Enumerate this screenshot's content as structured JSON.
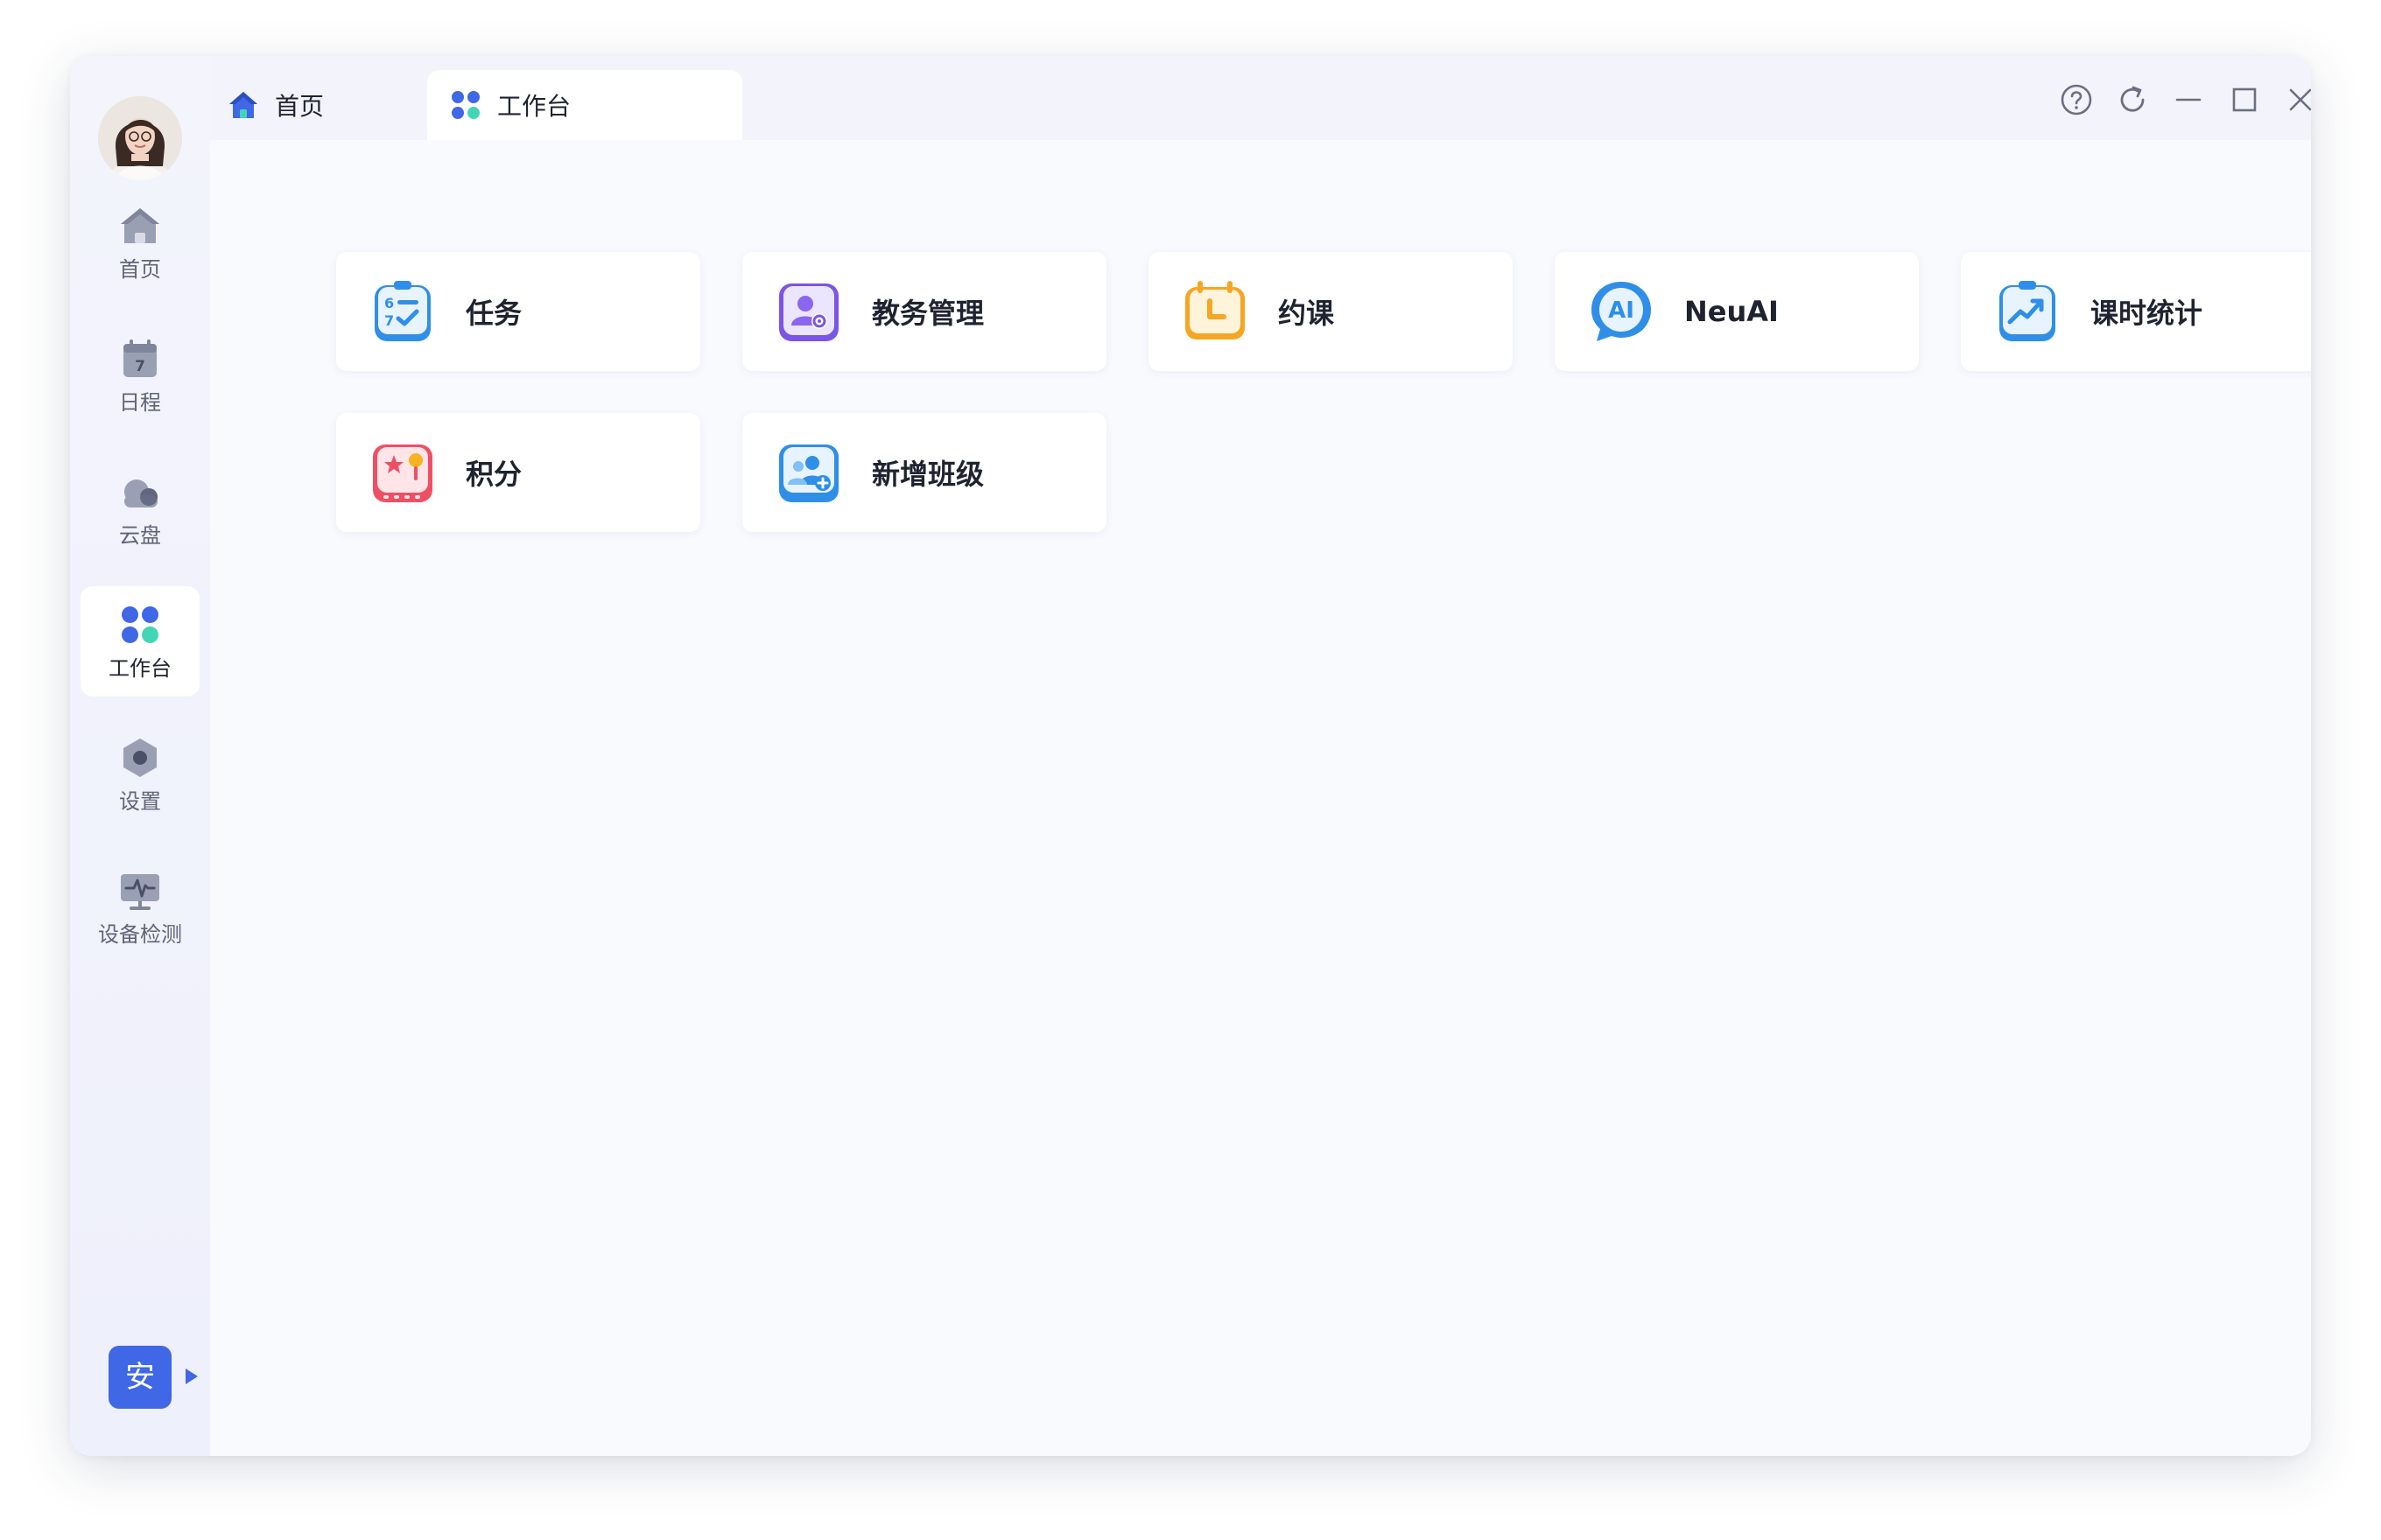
{
  "sidebar": {
    "items": [
      {
        "label": "首页",
        "icon": "home-icon"
      },
      {
        "label": "日程",
        "icon": "calendar-icon",
        "day": "7"
      },
      {
        "label": "云盘",
        "icon": "cloud-icon"
      },
      {
        "label": "工作台",
        "icon": "workbench-icon",
        "active": true
      },
      {
        "label": "设置",
        "icon": "settings-icon"
      },
      {
        "label": "设备检测",
        "icon": "device-check-icon"
      }
    ],
    "user_badge": "安"
  },
  "tabs": [
    {
      "label": "首页",
      "icon": "home-icon"
    },
    {
      "label": "工作台",
      "icon": "workbench-icon",
      "active": true
    }
  ],
  "window_controls": [
    "help-icon",
    "refresh-icon",
    "minimize-icon",
    "maximize-icon",
    "close-icon"
  ],
  "apps": [
    {
      "label": "任务",
      "icon": "task-icon"
    },
    {
      "label": "教务管理",
      "icon": "academic-management-icon"
    },
    {
      "label": "约课",
      "icon": "booking-icon"
    },
    {
      "label": "NeuAI",
      "icon": "neuai-icon",
      "icon_text": "AI"
    },
    {
      "label": "课时统计",
      "icon": "class-hours-stats-icon"
    },
    {
      "label": "积分",
      "icon": "points-icon"
    },
    {
      "label": "新增班级",
      "icon": "add-class-icon"
    }
  ],
  "colors": {
    "accent": "#3f67e6",
    "sidebar_icon": "#9aa0b4",
    "workbench_blue": "#3f67e6",
    "workbench_green": "#43d6b6"
  }
}
